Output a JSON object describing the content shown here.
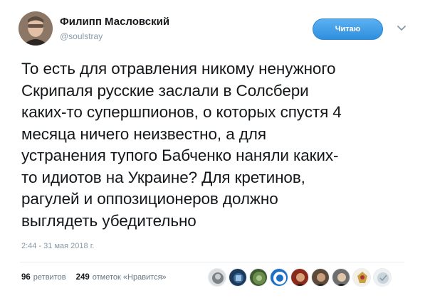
{
  "tweet": {
    "author_name": "Филипп Масловский",
    "author_handle": "@soulstray",
    "follow_button_label": "Читаю",
    "text": "То есть для отравления никому ненужного\nСкрипаля русские заслали в Солсбери\nкаких-то супершпионов, о которых спустя 4\nмесяца ничего неизвестно, а для\nустранения тупого Бабченко наняли каких-\nто идиотов на Украине? Для кретинов,\nрагулей и оппозиционеров должно\nвыглядеть убедительно",
    "timestamp": "2:44 - 31 мая 2018 г.",
    "stats": {
      "retweets_count": "96",
      "retweets_label": "ретвитов",
      "likes_count": "249",
      "likes_label": "отметок «Нравится»"
    }
  },
  "colors": {
    "follow_button": "#2f8fde",
    "secondary_text": "#8899a6",
    "divider": "#e6ecf0"
  },
  "icons": {
    "caret": "chevron-down-icon"
  }
}
